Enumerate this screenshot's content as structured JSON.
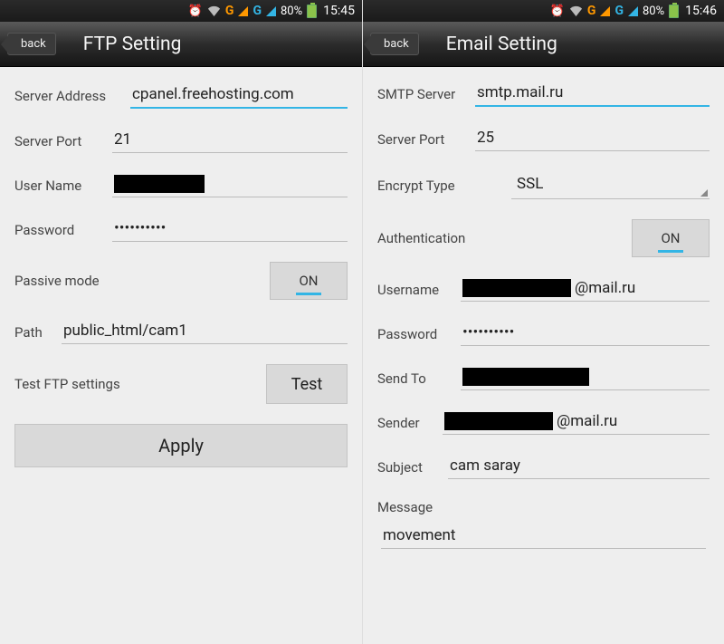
{
  "left": {
    "status": {
      "percent": "80%",
      "time": "15:45"
    },
    "header": {
      "back": "back",
      "title": "FTP Setting"
    },
    "fields": {
      "server_address_label": "Server Address",
      "server_address_value": "cpanel.freehosting.com",
      "server_port_label": "Server Port",
      "server_port_value": "21",
      "user_name_label": "User Name",
      "password_label": "Password",
      "password_value": "••••••••••",
      "passive_mode_label": "Passive mode",
      "passive_mode_value": "ON",
      "path_label": "Path",
      "path_value": "public_html/cam1",
      "test_label": "Test FTP settings",
      "test_button": "Test",
      "apply_button": "Apply"
    }
  },
  "right": {
    "status": {
      "percent": "80%",
      "time": "15:46"
    },
    "header": {
      "back": "back",
      "title": "Email Setting"
    },
    "fields": {
      "smtp_label": "SMTP Server",
      "smtp_value": "smtp.mail.ru",
      "server_port_label": "Server Port",
      "server_port_value": "25",
      "encrypt_label": "Encrypt Type",
      "encrypt_value": "SSL",
      "auth_label": "Authentication",
      "auth_value": "ON",
      "username_label": "Username",
      "username_suffix": "@mail.ru",
      "password_label": "Password",
      "password_value": "••••••••••",
      "sendto_label": "Send To",
      "sender_label": "Sender",
      "sender_suffix": "@mail.ru",
      "subject_label": "Subject",
      "subject_value": "cam saray",
      "message_label": "Message",
      "message_value": "movement"
    }
  }
}
